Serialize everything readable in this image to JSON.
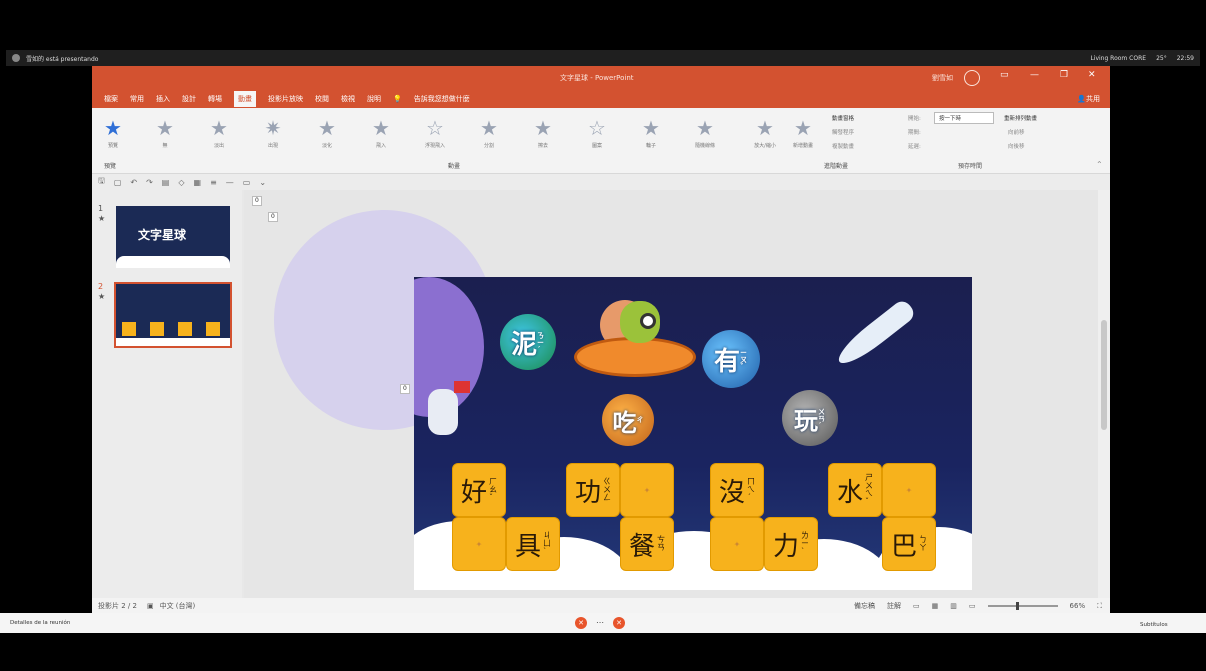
{
  "meeting": {
    "presenter": "雪如的 está presentando",
    "right_status": [
      "Living Room CORE",
      "25°",
      "22:59"
    ],
    "bottom_left": "Detalles de la reunión",
    "bottom_right_caption": "Subtítulos"
  },
  "window": {
    "title": "文字星球 - PowerPoint",
    "user": "劉雪如",
    "minimize": "—",
    "restore": "❐",
    "close": "✕"
  },
  "menu": {
    "tabs": [
      "檔案",
      "常用",
      "插入",
      "設計",
      "轉場",
      "動畫",
      "投影片放映",
      "校閱",
      "檢視",
      "說明"
    ],
    "active": "動畫",
    "search": "告訴我您想做什麼",
    "share": "共用"
  },
  "ribbon": {
    "preview_label": "預覽",
    "preview_group": "預覽",
    "animations": [
      "無",
      "淡出",
      "出現",
      "淡化",
      "飛入",
      "浮現飛入",
      "分割",
      "擦去",
      "圖案",
      "輪子",
      "隨機線條",
      "放大/縮小"
    ],
    "animations_group": "動畫",
    "effect_options": "效果選項",
    "add_animation": "新增動畫",
    "advanced_group": "進階動畫",
    "animation_pane": "動畫窗格",
    "trigger": "觸發程序",
    "animation_painter": "複製動畫",
    "start_label": "開始:",
    "start_value": "按一下時",
    "duration_label": "期間:",
    "delay_label": "延遲:",
    "timing_group": "預存時間",
    "reorder": "重新排列動畫",
    "move_earlier": "向前移",
    "move_later": "向後移"
  },
  "thumbnails": [
    {
      "num": "1",
      "title": "文字星球"
    },
    {
      "num": "2",
      "title": ""
    }
  ],
  "slide": {
    "tags": [
      "0",
      "0",
      "0"
    ],
    "planets": [
      "泥",
      "有",
      "玩",
      "吃"
    ],
    "planet_zhuyin": [
      "ㄋㄧˊ",
      "ㄧㄡˇ",
      "ㄨㄢˊ",
      "ㄔ"
    ],
    "cards": [
      {
        "char": "好",
        "zy": "ㄏㄠˇ"
      },
      {
        "char": "具",
        "zy": "ㄐㄩˋ"
      },
      {
        "char": "功",
        "zy": "ㄍㄨㄥ"
      },
      {
        "char": "餐",
        "zy": "ㄘㄢ"
      },
      {
        "char": "沒",
        "zy": "ㄇㄟˊ"
      },
      {
        "char": "力",
        "zy": "ㄌㄧˋ"
      },
      {
        "char": "水",
        "zy": "ㄕㄨㄟˇ"
      },
      {
        "char": "巴",
        "zy": "ㄅㄚ"
      }
    ]
  },
  "status": {
    "slide_count": "投影片 2 / 2",
    "language": "中文 (台灣)",
    "notes": "備忘稿",
    "comments": "註解",
    "zoom": "66%"
  }
}
